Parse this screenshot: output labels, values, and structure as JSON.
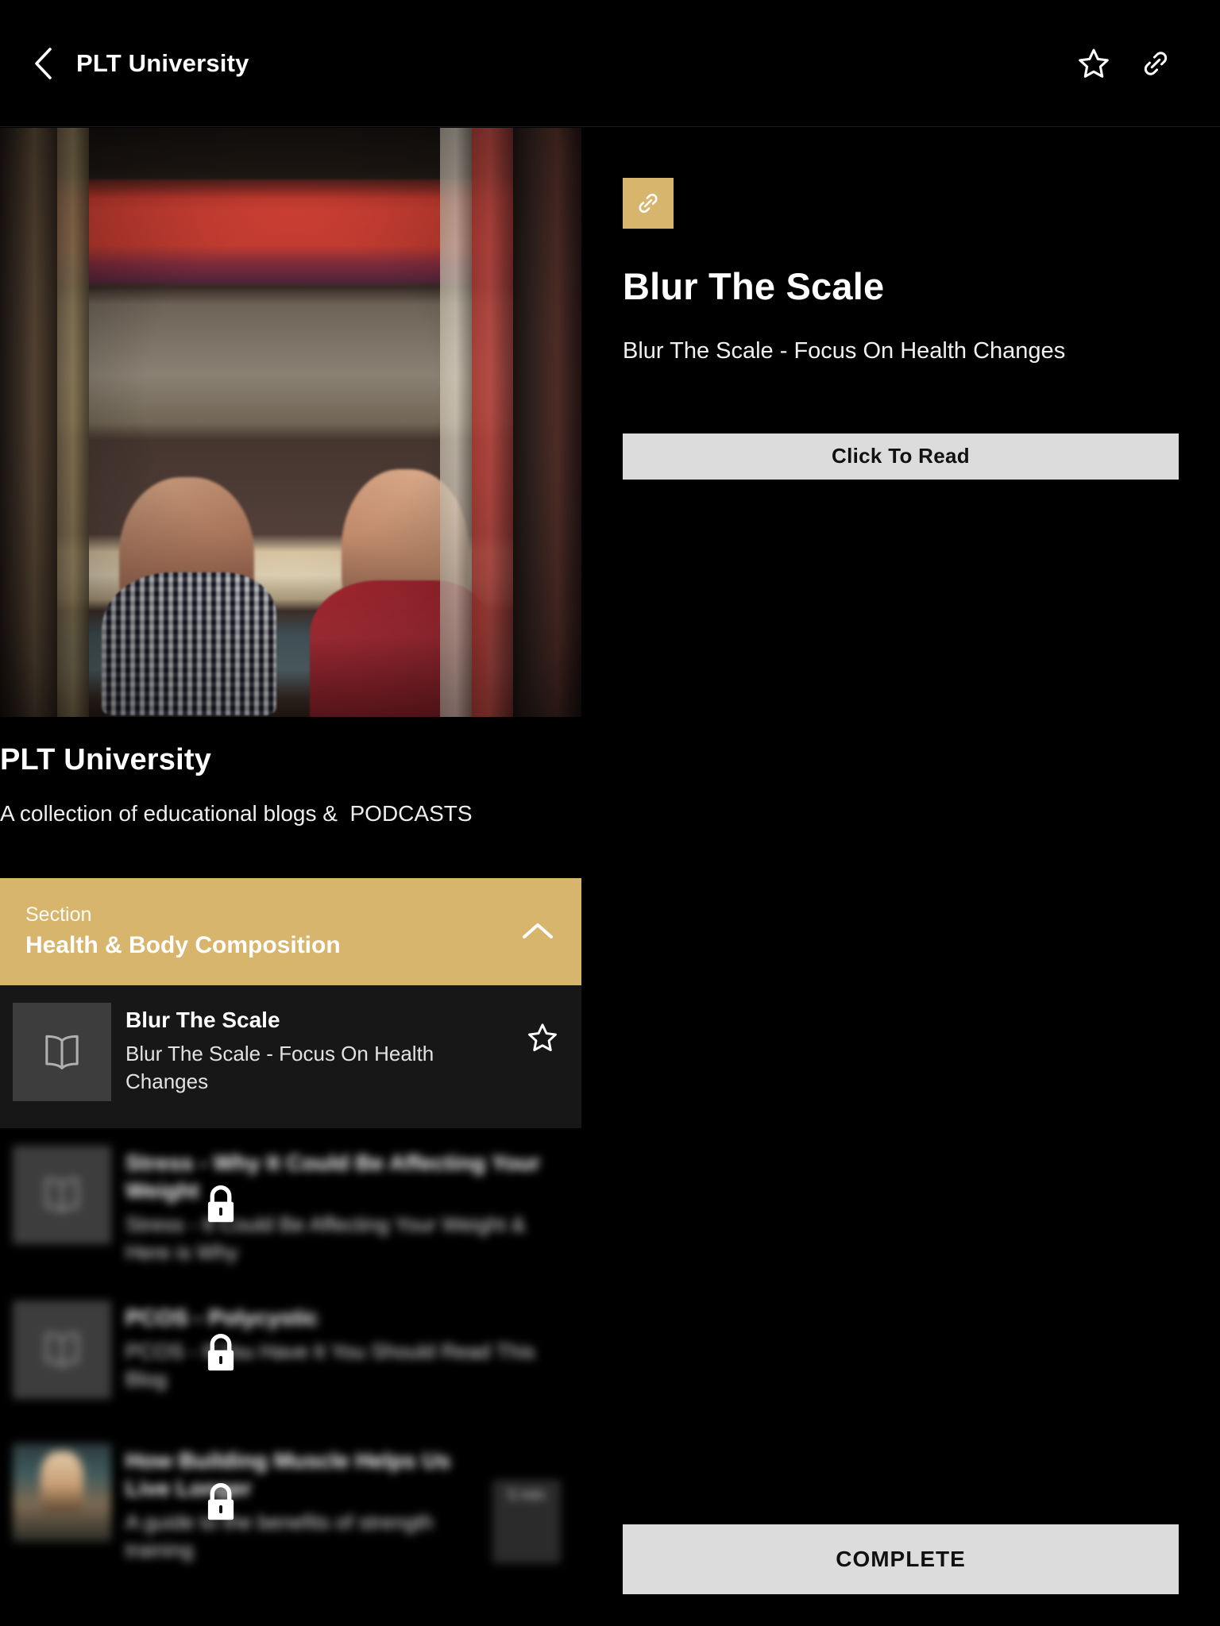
{
  "appbar": {
    "back_icon": "chevron-left-icon",
    "title": "PLT University",
    "favorite_icon": "star-outline-icon",
    "share_icon": "link-icon"
  },
  "course": {
    "hero_image_alt": "library-bookshelf-couple-photo",
    "title": "PLT University",
    "subtitle": "A collection of educational blogs &  PODCASTS"
  },
  "section": {
    "kicker": "Section",
    "name": "Health & Body Composition",
    "collapse_icon": "chevron-up-icon",
    "expanded": true
  },
  "lessons": [
    {
      "title": "Blur The Scale",
      "subtitle": "Blur The Scale - Focus On Health Changes",
      "thumb_icon": "book-open-icon",
      "state": "active",
      "locked": false,
      "favorite_icon": "star-outline-icon",
      "duration": ""
    },
    {
      "title": "Stress - Why It Could Be Affecting Your Weight",
      "subtitle": "Stress - It Could Be Affecting Your Weight & Here is Why",
      "thumb_icon": "book-open-icon",
      "state": "locked",
      "locked": true,
      "lock_icon": "lock-icon",
      "duration": ""
    },
    {
      "title": "PCOS - Polycystic",
      "subtitle": "PCOS - If You Have It You Should Read This Blog",
      "thumb_icon": "book-open-icon",
      "state": "locked",
      "locked": true,
      "lock_icon": "lock-icon",
      "duration": ""
    },
    {
      "title": "How Building Muscle Helps Us Live Longer",
      "subtitle": "A guide to the benefits of strength training",
      "thumb_icon": "photo-thumbnail",
      "state": "locked",
      "locked": true,
      "lock_icon": "lock-icon",
      "duration": "5 min"
    }
  ],
  "detail": {
    "type_icon": "link-icon",
    "title": "Blur The Scale",
    "subtitle": "Blur The Scale - Focus On Health Changes",
    "read_button": "Click To Read",
    "complete_button": "COMPLETE"
  },
  "colors": {
    "accent": "#D7B56D",
    "background": "#000000",
    "active_row": "#171717",
    "button": "#DCDCDC",
    "thumb": "#3D3D3D"
  }
}
